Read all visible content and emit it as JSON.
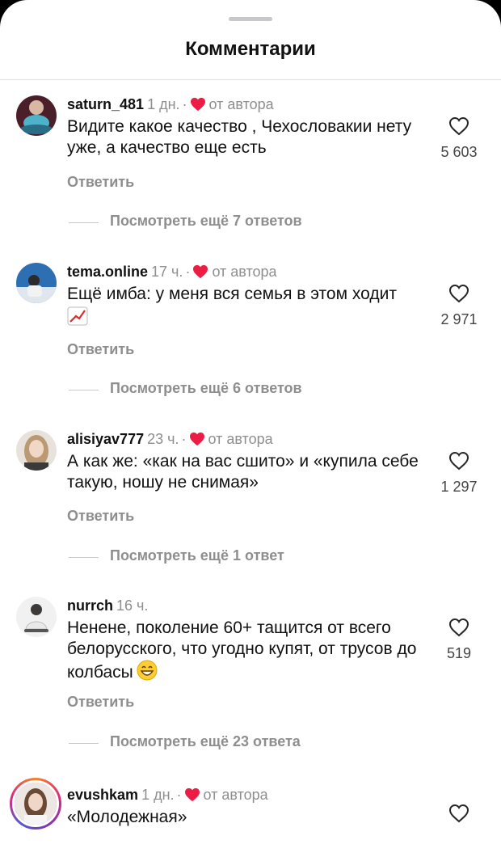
{
  "header": {
    "title": "Комментарии"
  },
  "comments": [
    {
      "username": "saturn_481",
      "time": "1 дн.",
      "separator": "·",
      "liked_by_author": "от автора",
      "text": "Видите какое качество , Чехословакии нету уже, а качество еще есть",
      "likes": "5 603",
      "reply_label": "Ответить",
      "more_replies": "Посмотреть ещё 7 ответов"
    },
    {
      "username": "tema.online",
      "time": "17 ч.",
      "separator": "·",
      "liked_by_author": "от автора",
      "text": "Ещё имба: у меня вся семья в этом ходит",
      "emoji": "chart-increasing-emoji",
      "likes": "2 971",
      "reply_label": "Ответить",
      "more_replies": "Посмотреть ещё 6 ответов"
    },
    {
      "username": "alisiyav777",
      "time": "23 ч.",
      "separator": "·",
      "liked_by_author": "от автора",
      "text": "А как же: «как на вас сшито» и «купила себе такую, ношу не снимая»",
      "likes": "1 297",
      "reply_label": "Ответить",
      "more_replies": "Посмотреть ещё 1 ответ"
    },
    {
      "username": "nurrch",
      "time": "16 ч.",
      "text": "Ненене, поколение 60+ тащится от всего белорусского, что угодно купят, от трусов до колбасы",
      "emoji": "grinning-face-emoji",
      "likes": "519",
      "reply_label": "Ответить",
      "more_replies": "Посмотреть ещё 23 ответа"
    },
    {
      "username": "evushkam",
      "time": "1 дн.",
      "separator": "·",
      "liked_by_author": "от автора",
      "text": "«Молодежная»"
    }
  ],
  "colors": {
    "author_heart": "#ed1c45",
    "muted": "#8e8e8e",
    "text": "#111111"
  },
  "icons": {
    "like": "heart-outline-icon",
    "author_like": "heart-filled-icon"
  }
}
